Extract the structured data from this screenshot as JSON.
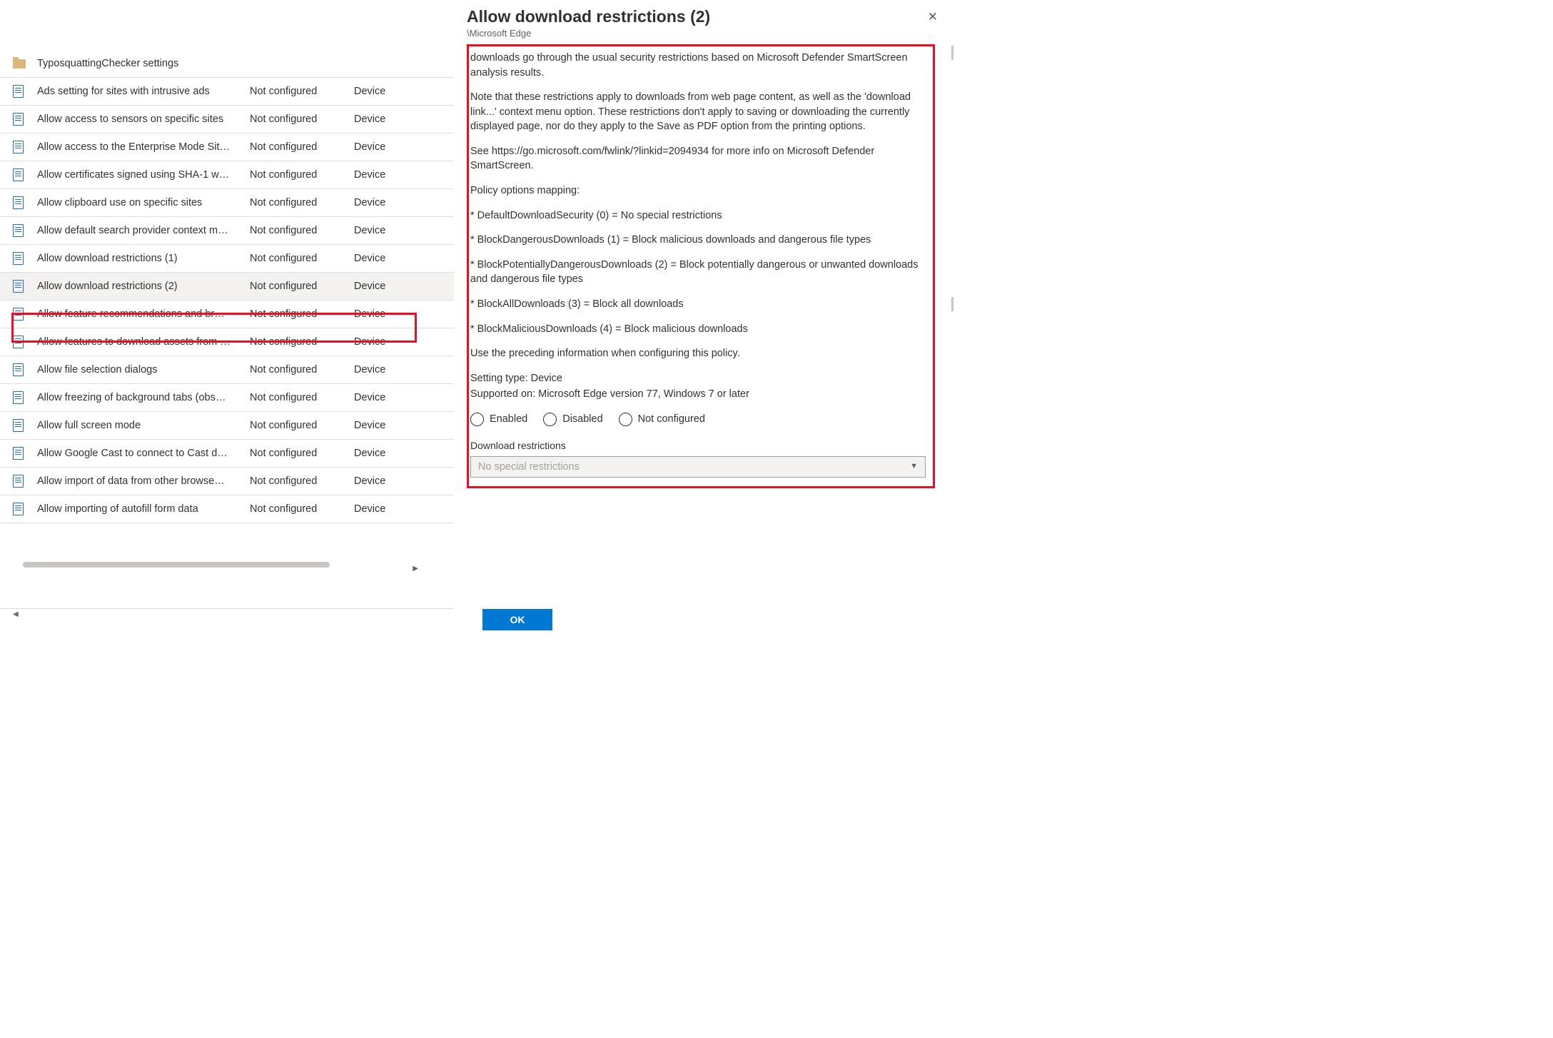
{
  "panel": {
    "title": "Allow download restrictions (2)",
    "path": "\\Microsoft Edge",
    "ok": "OK",
    "radios": {
      "enabled": "Enabled",
      "disabled": "Disabled",
      "notconfig": "Not configured"
    },
    "dropdown_label": "Download restrictions",
    "dropdown_value": "No special restrictions",
    "desc": {
      "p1": "downloads go through the usual security restrictions based on Microsoft Defender SmartScreen analysis results.",
      "p2": "Note that these restrictions apply to downloads from web page content, as well as the 'download link...' context menu option. These restrictions don't apply to saving or downloading the currently displayed page, nor do they apply to the Save as PDF option from the printing options.",
      "p3": "See https://go.microsoft.com/fwlink/?linkid=2094934 for more info on Microsoft Defender SmartScreen.",
      "p4": "Policy options mapping:",
      "opt0": "* DefaultDownloadSecurity (0) = No special restrictions",
      "opt1": "* BlockDangerousDownloads (1) = Block malicious downloads and dangerous file types",
      "opt2": "* BlockPotentiallyDangerousDownloads (2) = Block potentially dangerous or unwanted downloads and dangerous file types",
      "opt3": "* BlockAllDownloads (3) = Block all downloads",
      "opt4": "* BlockMaliciousDownloads (4) = Block malicious downloads",
      "p5": "Use the preceding information when configuring this policy.",
      "p6": "Setting type: Device",
      "p7": "Supported on: Microsoft Edge version 77, Windows 7 or later"
    }
  },
  "rows": [
    {
      "kind": "folder",
      "name": "TyposquattingChecker settings",
      "state": "",
      "type": ""
    },
    {
      "kind": "doc",
      "name": "Ads setting for sites with intrusive ads",
      "state": "Not configured",
      "type": "Device"
    },
    {
      "kind": "doc",
      "name": "Allow access to sensors on specific sites",
      "state": "Not configured",
      "type": "Device"
    },
    {
      "kind": "doc",
      "name": "Allow access to the Enterprise Mode Sit…",
      "state": "Not configured",
      "type": "Device"
    },
    {
      "kind": "doc",
      "name": "Allow certificates signed using SHA-1 w…",
      "state": "Not configured",
      "type": "Device"
    },
    {
      "kind": "doc",
      "name": "Allow clipboard use on specific sites",
      "state": "Not configured",
      "type": "Device"
    },
    {
      "kind": "doc",
      "name": "Allow default search provider context m…",
      "state": "Not configured",
      "type": "Device"
    },
    {
      "kind": "doc",
      "name": "Allow download restrictions (1)",
      "state": "Not configured",
      "type": "Device"
    },
    {
      "kind": "doc",
      "name": "Allow download restrictions (2)",
      "state": "Not configured",
      "type": "Device",
      "selected": true
    },
    {
      "kind": "doc",
      "name": "Allow feature recommendations and br…",
      "state": "Not configured",
      "type": "Device"
    },
    {
      "kind": "doc",
      "name": "Allow features to download assets from …",
      "state": "Not configured",
      "type": "Device"
    },
    {
      "kind": "doc",
      "name": "Allow file selection dialogs",
      "state": "Not configured",
      "type": "Device"
    },
    {
      "kind": "doc",
      "name": "Allow freezing of background tabs (obs…",
      "state": "Not configured",
      "type": "Device"
    },
    {
      "kind": "doc",
      "name": "Allow full screen mode",
      "state": "Not configured",
      "type": "Device"
    },
    {
      "kind": "doc",
      "name": "Allow Google Cast to connect to Cast d…",
      "state": "Not configured",
      "type": "Device"
    },
    {
      "kind": "doc",
      "name": "Allow import of data from other browse…",
      "state": "Not configured",
      "type": "Device"
    },
    {
      "kind": "doc",
      "name": "Allow importing of autofill form data",
      "state": "Not configured",
      "type": "Device"
    }
  ]
}
